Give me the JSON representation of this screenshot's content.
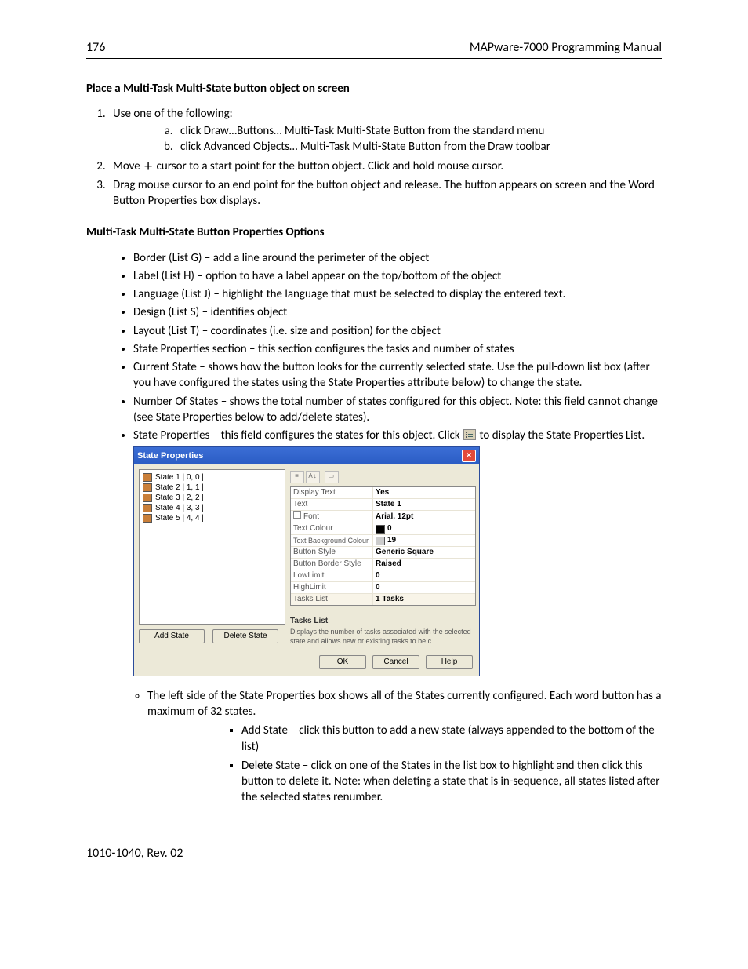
{
  "header": {
    "page_no": "176",
    "title": "MAPware-7000 Programming Manual"
  },
  "section1": {
    "heading": "Place a Multi-Task Multi-State button object on screen",
    "items": {
      "i1": "Use one of the following:",
      "i1a": "click Draw…Buttons… Multi-Task Multi-State Button from the standard menu",
      "i1b": "click Advanced Objects… Multi-Task Multi-State Button from the Draw toolbar",
      "i2a": "Move",
      "i2b": "cursor to a start point for the button object. Click and hold mouse cursor.",
      "i3": "Drag mouse cursor to an end point for the button object and release. The button appears on screen and the Word Button Properties box displays."
    }
  },
  "section2": {
    "heading": "Multi-Task Multi-State Button Properties Options",
    "bullets": {
      "b1": "Border (List G) – add a line around the perimeter of the object",
      "b2": "Label (List H) – option to have a label appear on the top/bottom of the object",
      "b3": "Language (List J) – highlight the language that must be selected to display the entered text.",
      "b4": "Design (List S) – identifies object",
      "b5": "Layout (List T) – coordinates (i.e. size and position) for the object",
      "b6": "State Properties section – this section configures the tasks and number of states",
      "b7": "Current State – shows how the button looks for the currently selected state. Use the pull-down list box (after you have configured the states using the State Properties attribute below) to change the state.",
      "b8": "Number Of States – shows the total number of states configured for this object.  Note: this field cannot change (see State Properties below to add/delete states).",
      "b9a": "State Properties – this field configures the states for this object.  Click",
      "b9b": "to display the State Properties List."
    }
  },
  "dialog": {
    "title": "State Properties",
    "states": {
      "s1": "State 1 | 0, 0 |",
      "s2": "State 2 | 1, 1 |",
      "s3": "State 3 | 2, 2 |",
      "s4": "State 4 | 3, 3 |",
      "s5": "State 5 | 4, 4 |"
    },
    "add_state": "Add State",
    "delete_state": "Delete State",
    "props": {
      "k1": "Display Text",
      "v1": "Yes",
      "k2": "Text",
      "v2": "State 1",
      "k3": "Font",
      "v3": "Arial, 12pt",
      "k4": "Text Colour",
      "v4": "0",
      "k5": "Text Background Colour",
      "v5": "19",
      "k6": "Button Style",
      "v6": "Generic Square",
      "k7": "Button Border Style",
      "v7": "Raised",
      "k8": "LowLimit",
      "v8": "0",
      "k9": "HighLimit",
      "v9": "0",
      "k10": "Tasks List",
      "v10": "1 Tasks"
    },
    "desc_title": "Tasks List",
    "desc_body": "Displays the number of tasks associated with the selected state and allows new or existing tasks to be c...",
    "ok": "OK",
    "cancel": "Cancel",
    "help": "Help"
  },
  "after_dialog": {
    "circle1": "The left side of the State Properties box shows all of the States currently configured.  Each word button has a maximum of 32 states.",
    "sq1": "Add State – click this button to add a new state (always appended to the bottom of the list)",
    "sq2": "Delete State – click on one of the States in the list box to highlight and then click this button to delete it.  Note: when deleting a state that is in-sequence, all states listed after the selected states renumber."
  },
  "footer": "1010-1040, Rev. 02"
}
